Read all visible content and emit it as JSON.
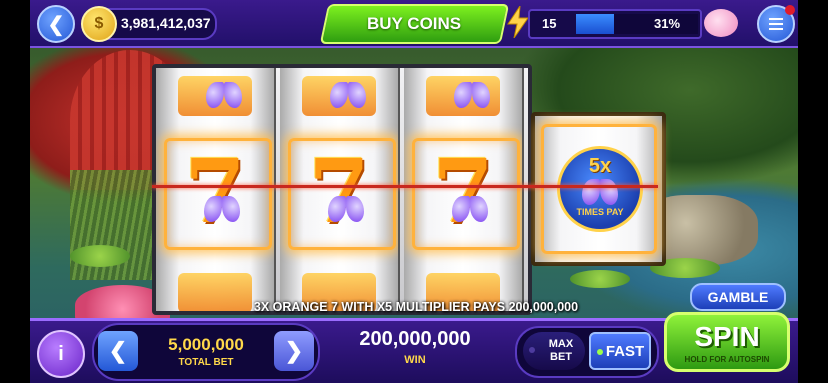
{
  "header": {
    "coin_balance": "3,981,412,037",
    "buy_coins_label": "BUY COINS",
    "level": "15",
    "level_progress_percent": 31,
    "level_progress_label": "31%"
  },
  "reels": {
    "multiplier_label": "5x",
    "multiplier_sub": "TIMES PAY",
    "payline_symbol": "7"
  },
  "win_message": "3X ORANGE 7 WITH X5 MULTIPLIER PAYS 200,000,000",
  "gamble_label": "GAMBLE",
  "bottom": {
    "info_label": "i",
    "total_bet_value": "5,000,000",
    "total_bet_label": "TOTAL BET",
    "win_value": "200,000,000",
    "win_label": "WIN",
    "max_bet_label": "MAX BET",
    "fast_label": "FAST",
    "spin_label": "SPIN",
    "spin_sub": "HOLD FOR AUTOSPIN"
  },
  "icons": {
    "back": "chevron-left",
    "coin": "coin",
    "bolt": "lightning-bolt",
    "piggy": "piggy-bank",
    "menu": "hamburger-menu",
    "bet_decrease": "chevron-left",
    "bet_increase": "chevron-right"
  },
  "colors": {
    "panel": "#22106a",
    "accent_green": "#2f9e10",
    "accent_blue": "#2458d6",
    "gold_text": "#ffd84a"
  }
}
